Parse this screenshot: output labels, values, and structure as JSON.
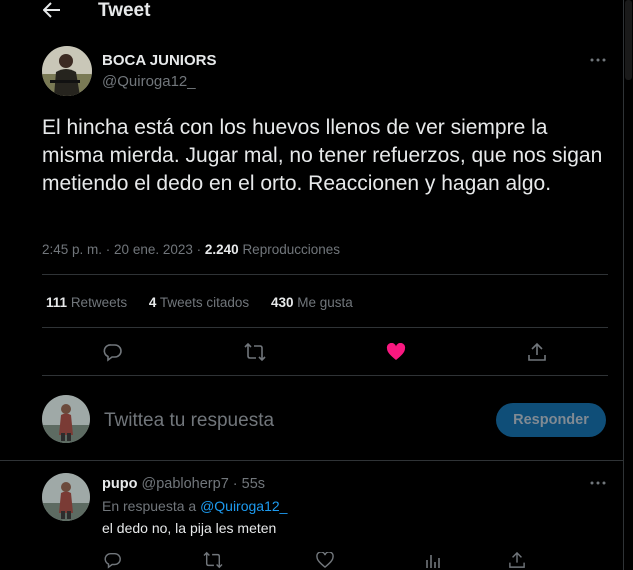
{
  "header": {
    "title": "Tweet"
  },
  "tweet": {
    "author_name": "BOCA JUNIORS",
    "author_handle": "@Quiroga12_",
    "text": "El hincha está con los huevos llenos de ver siempre la misma mierda. Jugar mal, no tener refuerzos, que nos sigan metiendo el dedo en el orto. Reaccionen y hagan algo.",
    "time": "2:45 p. m.",
    "separator": " · ",
    "date": "20 ene. 2023",
    "views_count": "2.240",
    "views_label": "Reproducciones",
    "retweets_count": "111",
    "retweets_label": "Retweets",
    "quotes_count": "4",
    "quotes_label": "Tweets citados",
    "likes_count": "430",
    "likes_label": "Me gusta",
    "liked": true
  },
  "composer": {
    "placeholder": "Twittea tu respuesta",
    "reply_button": "Responder"
  },
  "reply": {
    "author_name": "pupo",
    "author_handle": "@pabloherp7",
    "age": "55s",
    "in_reply_prefix": "En respuesta a",
    "in_reply_handle": "@Quiroga12_",
    "text": "el dedo no, la pija les meten"
  },
  "icons": [
    "back-arrow-icon",
    "more-icon",
    "reply-icon",
    "retweet-icon",
    "heart-filled-icon",
    "share-icon",
    "heart-icon",
    "analytics-icon"
  ],
  "colors": {
    "like": "#f91880",
    "link": "#1d9bf0",
    "button_bg": "#0f4e78",
    "muted": "#71767b"
  }
}
